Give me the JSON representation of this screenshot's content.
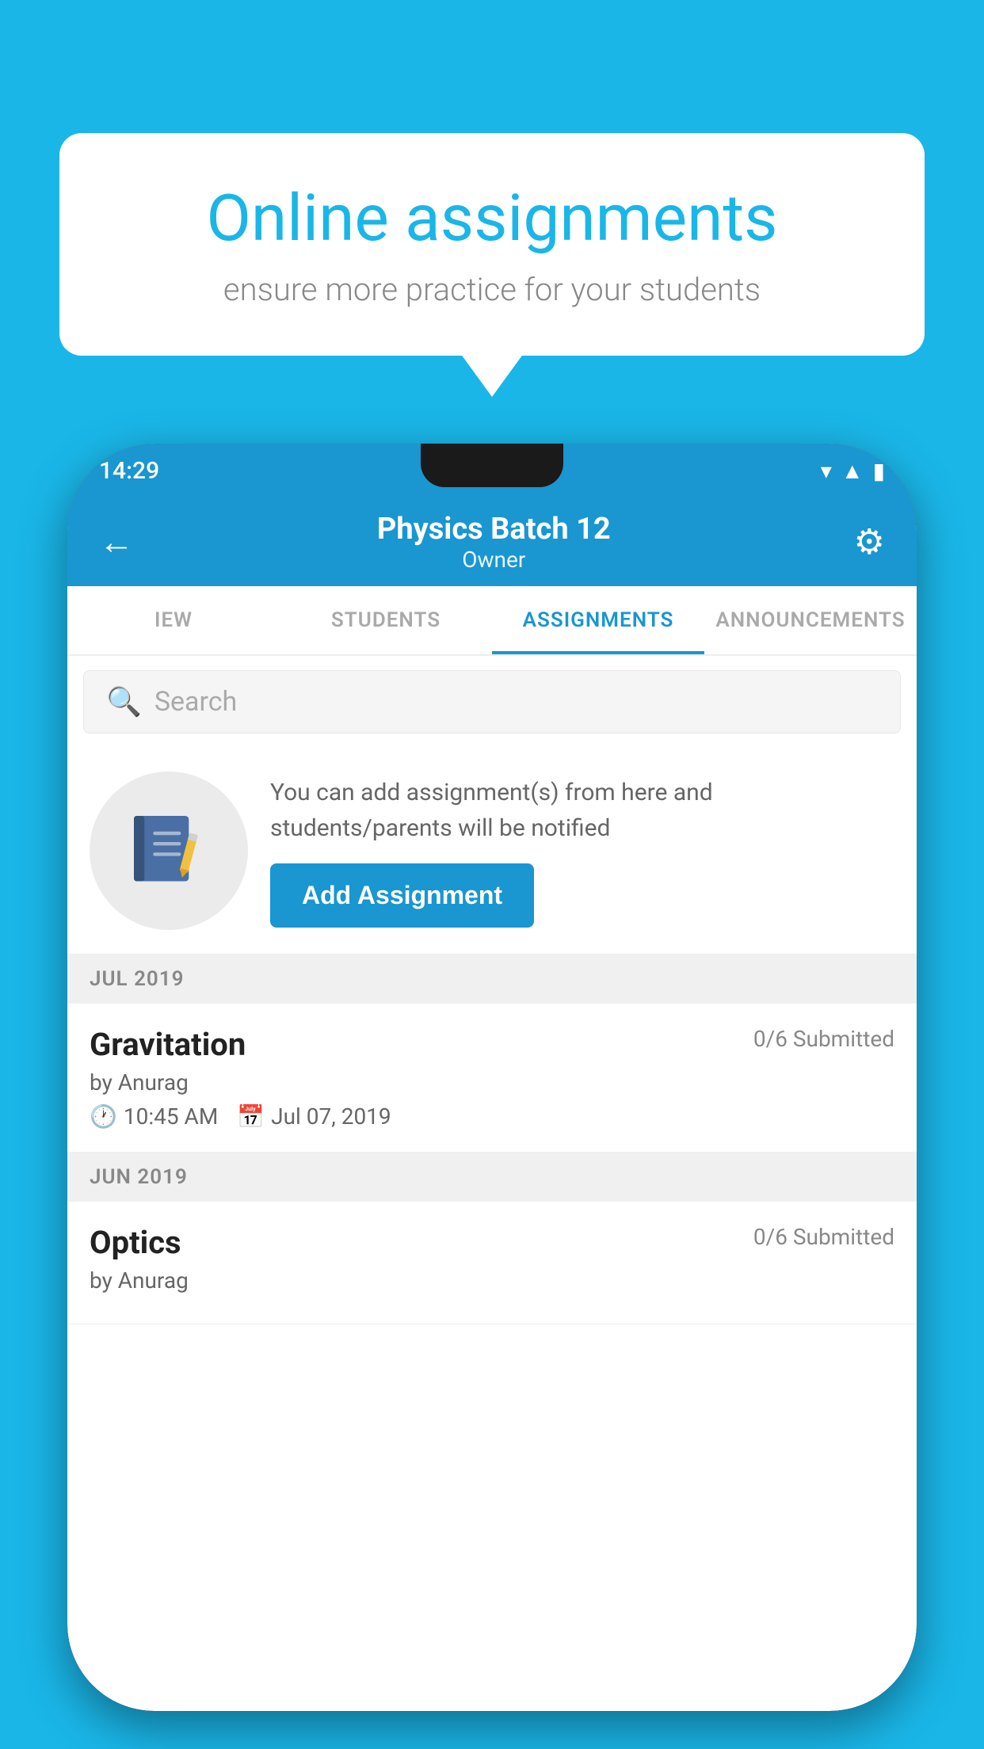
{
  "background_color": "#1ab6e8",
  "speech_bubble": {
    "title": "Online assignments",
    "subtitle": "ensure more practice for your students"
  },
  "status_bar": {
    "time": "14:29",
    "icons": [
      "wifi",
      "signal",
      "battery"
    ]
  },
  "app_bar": {
    "title": "Physics Batch 12",
    "subtitle": "Owner",
    "back_label": "←",
    "settings_label": "⚙"
  },
  "tabs": [
    {
      "label": "IEW",
      "active": false
    },
    {
      "label": "STUDENTS",
      "active": false
    },
    {
      "label": "ASSIGNMENTS",
      "active": true
    },
    {
      "label": "ANNOUNCEMENTS",
      "active": false
    }
  ],
  "search": {
    "placeholder": "Search"
  },
  "promo": {
    "text": "You can add assignment(s) from here and students/parents will be notified",
    "button_label": "Add Assignment"
  },
  "sections": [
    {
      "header": "JUL 2019",
      "assignments": [
        {
          "name": "Gravitation",
          "submitted": "0/6 Submitted",
          "author": "by Anurag",
          "time": "10:45 AM",
          "date": "Jul 07, 2019"
        }
      ]
    },
    {
      "header": "JUN 2019",
      "assignments": [
        {
          "name": "Optics",
          "submitted": "0/6 Submitted",
          "author": "by Anurag",
          "time": "",
          "date": ""
        }
      ]
    }
  ]
}
